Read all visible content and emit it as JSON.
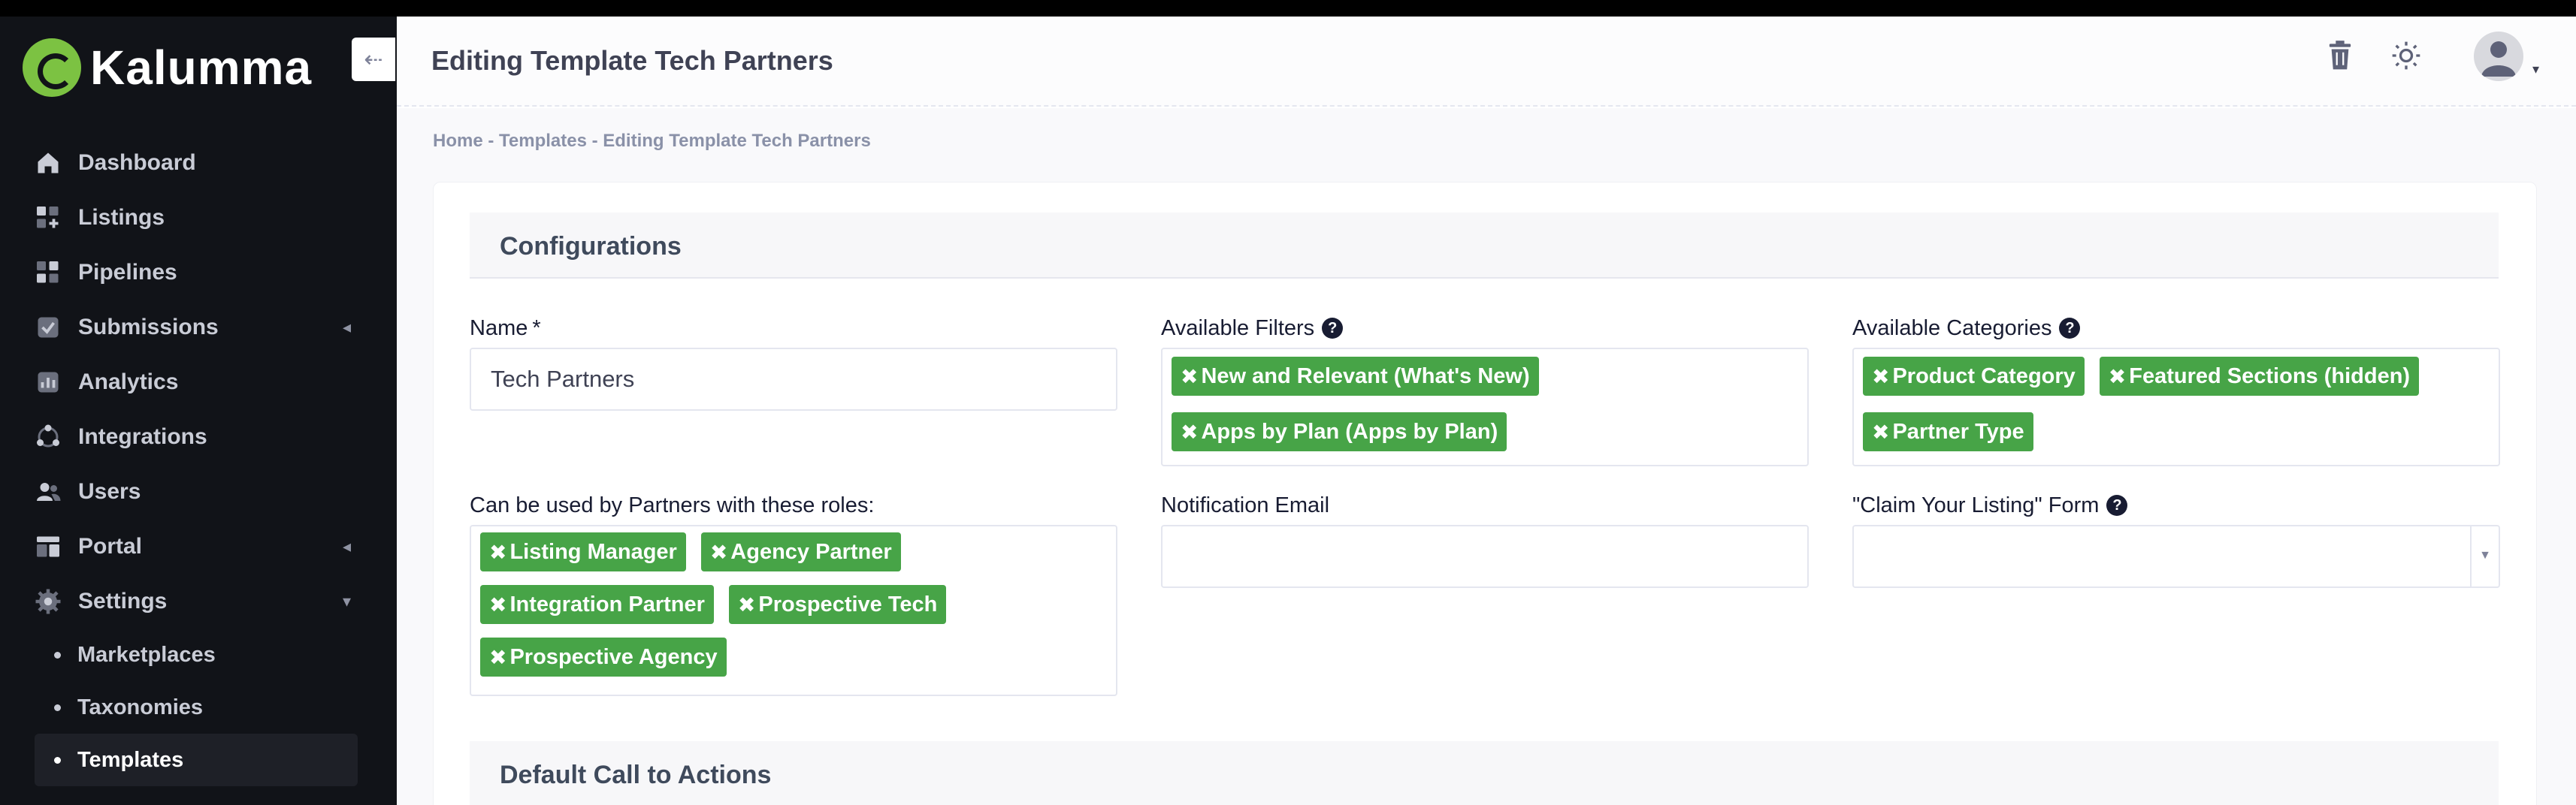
{
  "app": {
    "name": "Kalumma"
  },
  "sidebar": {
    "collapse_icon": "arrow-left-icon",
    "items": [
      {
        "label": "Dashboard",
        "icon": "home-icon"
      },
      {
        "label": "Listings",
        "icon": "grid-add-icon"
      },
      {
        "label": "Pipelines",
        "icon": "columns-icon"
      },
      {
        "label": "Submissions",
        "icon": "check-square-icon"
      },
      {
        "label": "Analytics",
        "icon": "chart-icon"
      },
      {
        "label": "Integrations",
        "icon": "nodes-icon"
      },
      {
        "label": "Users",
        "icon": "users-icon"
      },
      {
        "label": "Portal",
        "icon": "portal-icon"
      },
      {
        "label": "Settings",
        "icon": "gear-icon"
      }
    ],
    "settings_sub": [
      {
        "label": "Marketplaces"
      },
      {
        "label": "Taxonomies"
      },
      {
        "label": "Templates"
      }
    ]
  },
  "header": {
    "title": "Editing Template Tech Partners",
    "icons": [
      "trash-icon",
      "sun-icon",
      "avatar"
    ]
  },
  "breadcrumb": "Home - Templates - Editing Template Tech Partners",
  "sections": {
    "configurations": "Configurations",
    "default_cta": "Default Call to Actions"
  },
  "form": {
    "name_label": "Name",
    "name_required": "*",
    "name_value": "Tech Partners",
    "filters_label": "Available Filters",
    "filters": [
      "New and Relevant (What's New)",
      "Apps by Plan (Apps by Plan)"
    ],
    "categories_label": "Available Categories",
    "categories": [
      "Product Category",
      "Featured Sections (hidden)",
      "Partner Type"
    ],
    "roles_label": "Can be used by Partners with these roles:",
    "roles": [
      "Listing Manager",
      "Agency Partner",
      "Integration Partner",
      "Prospective Tech",
      "Prospective Agency"
    ],
    "email_label": "Notification Email",
    "email_value": "",
    "claim_label": "\"Claim Your Listing\" Form",
    "claim_value": ""
  },
  "colors": {
    "tag_green": "#47a447",
    "sidebar_bg": "#111318",
    "brand_green": "#7cc242"
  }
}
